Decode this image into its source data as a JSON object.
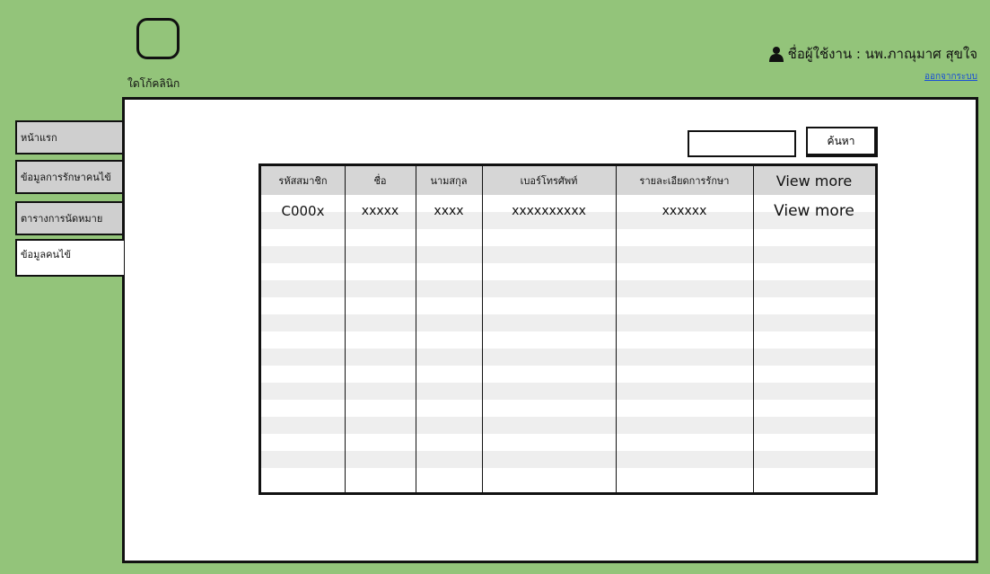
{
  "app": {
    "logo_label": "ใดโก้คลินิก"
  },
  "user": {
    "label": "ชื่อผู้ใช้งาน : นพ.ภาณุมาศ  สุขใจ",
    "logout": "ออกจากระบบ"
  },
  "sidebar": {
    "items": [
      {
        "label": "หน้าแรก"
      },
      {
        "label": "ข้อมูลการรักษาคนไข้"
      },
      {
        "label": "ตารางการนัดหมาย"
      },
      {
        "label": "ข้อมูลคนไข้"
      }
    ],
    "active_index": 3
  },
  "search": {
    "value": "",
    "button_label": "ค้นหา"
  },
  "table": {
    "headers": [
      "รหัสสมาชิก",
      "ชื่อ",
      "นามสกุล",
      "เบอร์โทรศัพท์",
      "รายละเอียดการรักษา",
      "View more"
    ],
    "rows": [
      [
        "C000x",
        "xxxxx",
        "xxxx",
        "xxxxxxxxxx",
        "xxxxxx",
        "View more"
      ]
    ]
  },
  "colors": {
    "background": "#93c47a",
    "panel": "#ffffff",
    "tab_inactive": "#cfcfcf",
    "link": "#1a4fd6"
  }
}
